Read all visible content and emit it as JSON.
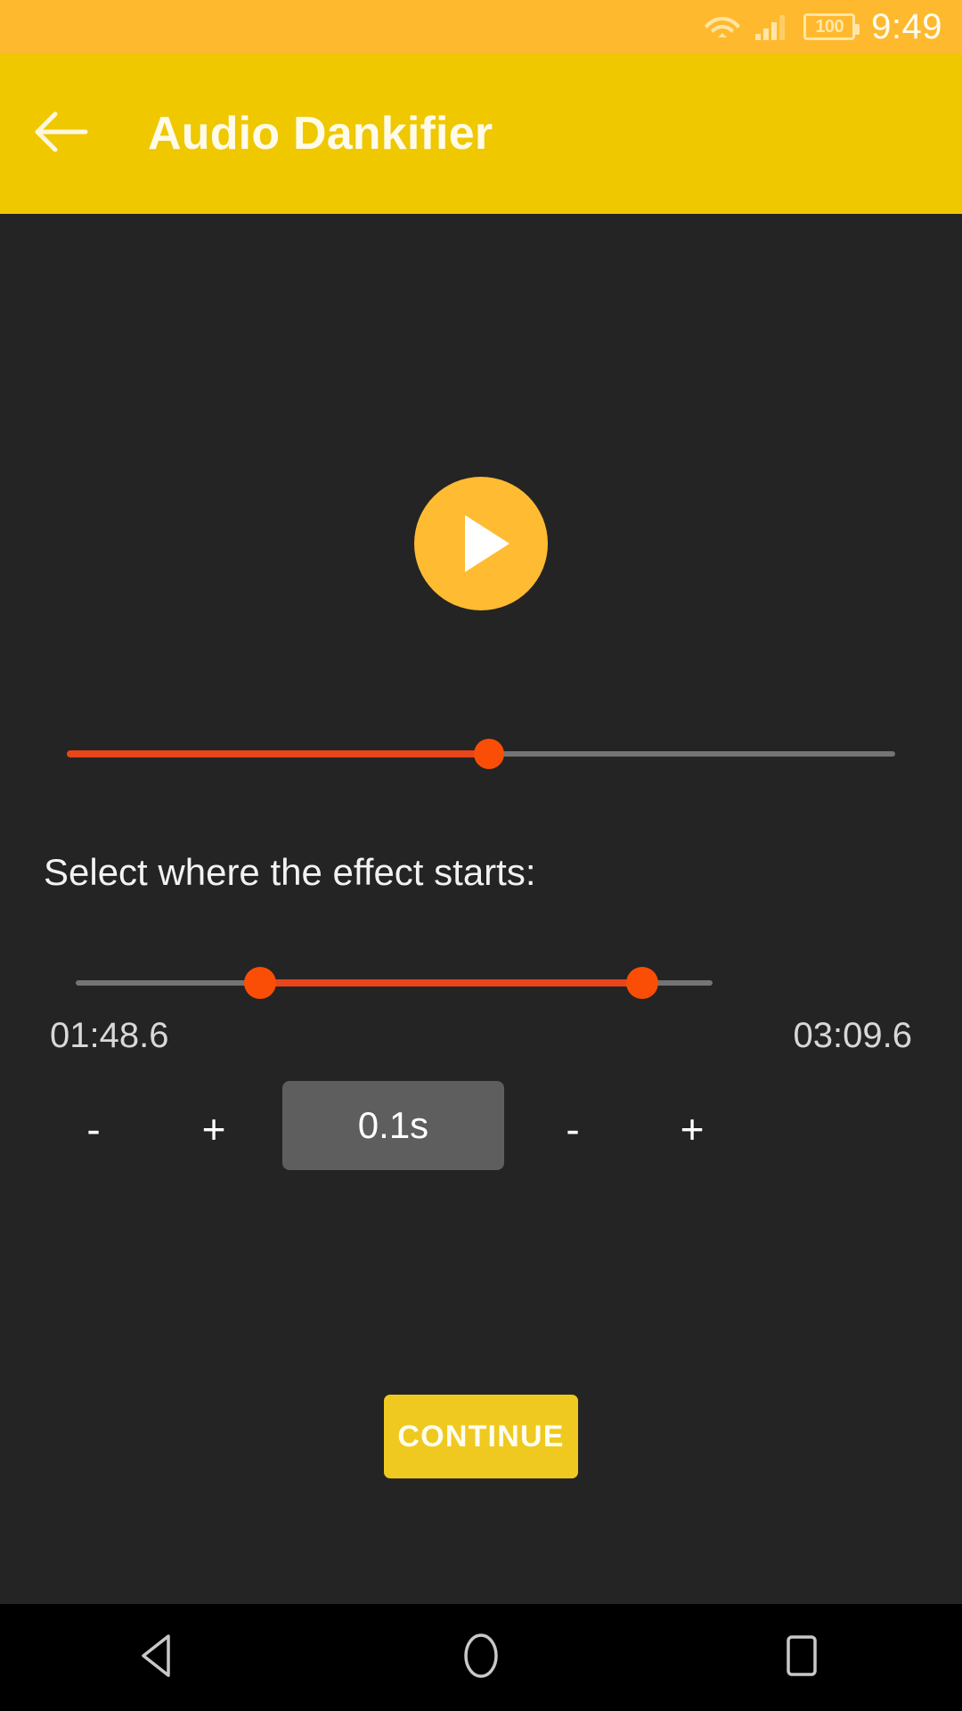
{
  "status_bar": {
    "wifi_icon": "wifi-icon",
    "signal_icon": "cellular-signal-icon",
    "battery_icon": "battery-icon",
    "battery_level": "100",
    "time": "9:49",
    "background_color": "#FFB92E"
  },
  "app_bar": {
    "back_icon": "arrow-back-icon",
    "title": "Audio Dankifier",
    "background_color": "#EFC800",
    "text_color": "#FFFBEA"
  },
  "main": {
    "background_color": "#242424",
    "player": {
      "play_icon": "play-icon",
      "button_color": "#FFBB32",
      "progress": {
        "percent": 51,
        "fill_color": "#E8451A",
        "track_color": "#747474",
        "thumb_color": "#FA4E06"
      }
    },
    "section_label": "Select where the effect starts:",
    "range": {
      "start_percent": 29,
      "end_percent": 89,
      "fill_color": "#E8451A",
      "track_color": "#747474",
      "thumb_color": "#FA4E06",
      "start_time": "01:48.6",
      "end_time": "03:09.6"
    },
    "stepper": {
      "left_minus": "-",
      "left_plus": "+",
      "step_value": "0.1s",
      "right_minus": "-",
      "right_plus": "+",
      "value_bg_color": "#5E5E5E"
    },
    "continue_label": "CONTINUE",
    "continue_color": "#EFC91F"
  },
  "nav_bar": {
    "back_icon": "nav-back-triangle-icon",
    "home_icon": "nav-home-circle-icon",
    "recents_icon": "nav-recents-square-icon",
    "background_color": "#000000",
    "icon_color": "#C8C8C8"
  }
}
